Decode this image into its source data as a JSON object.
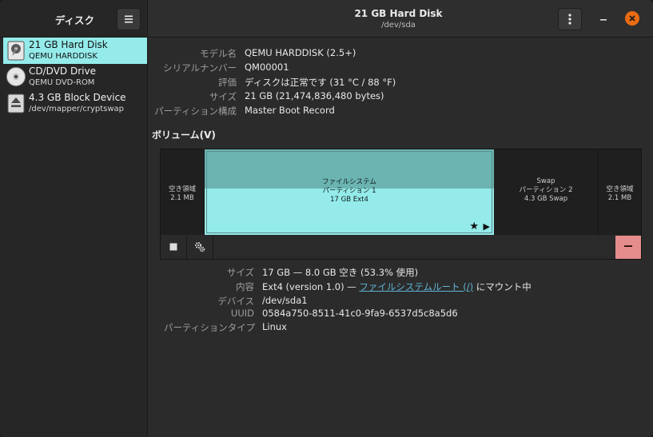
{
  "app": {
    "title": "ディスク"
  },
  "header": {
    "title": "21 GB Hard Disk",
    "subtitle": "/dev/sda"
  },
  "sidebar": {
    "devices": [
      {
        "name": "21 GB Hard Disk",
        "sub": "QEMU HARDDISK",
        "icon": "hard-disk-icon",
        "selected": true
      },
      {
        "name": "CD/DVD Drive",
        "sub": "QEMU DVD-ROM",
        "icon": "optical-disc-icon",
        "selected": false
      },
      {
        "name": "4.3 GB Block Device",
        "sub": "/dev/mapper/cryptswap",
        "icon": "block-device-icon",
        "selected": false
      }
    ]
  },
  "disk_info": {
    "model_label": "モデル名",
    "model": "QEMU HARDDISK (2.5+)",
    "serial_label": "シリアルナンバー",
    "serial": "QM00001",
    "assessment_label": "評価",
    "assessment": "ディスクは正常です (31 °C / 88 °F)",
    "size_label": "サイズ",
    "size": "21 GB (21,474,836,480 bytes)",
    "partitioning_label": "パーティション構成",
    "partitioning": "Master Boot Record"
  },
  "volumes": {
    "heading": "ボリューム(V)",
    "free1": {
      "line1": "空き領域",
      "line2": "2.1 MB"
    },
    "part1": {
      "line1": "ファイルシステム",
      "line2": "パーティション 1",
      "line3": "17 GB Ext4"
    },
    "swap": {
      "line1": "Swap",
      "line2": "パーティション 2",
      "line3": "4.3 GB Swap"
    },
    "free2": {
      "line1": "空き領域",
      "line2": "2.1 MB"
    }
  },
  "partition_info": {
    "size_label": "サイズ",
    "size": "17 GB — 8.0 GB 空き (53.3% 使用)",
    "contents_label": "内容",
    "contents_prefix": "Ext4 (version 1.0) — ",
    "contents_link": "ファイルシステムルート (/)",
    "contents_suffix": " にマウント中",
    "device_label": "デバイス",
    "device": "/dev/sda1",
    "uuid_label": "UUID",
    "uuid": "0584a750-8511-41c0-9fa9-6537d5c8a5d6",
    "type_label": "パーティションタイプ",
    "type": "Linux"
  }
}
